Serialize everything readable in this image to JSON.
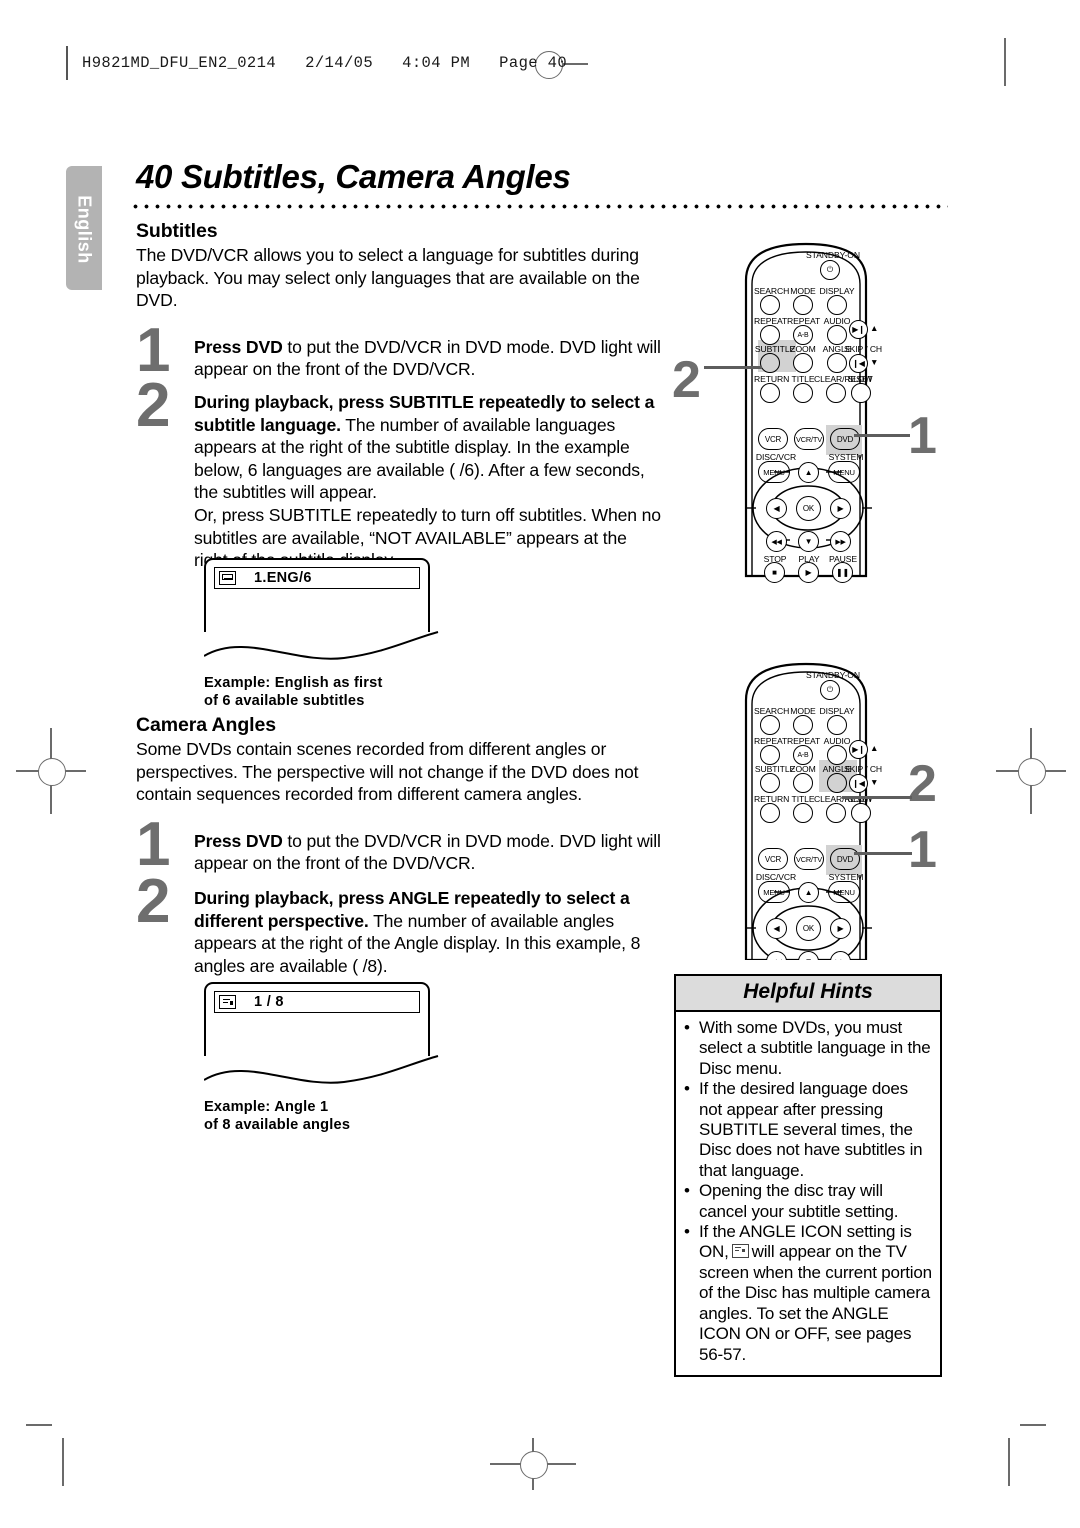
{
  "header": {
    "slug": "H9821MD_DFU_EN2_0214   2/14/05   4:04 PM   Page 40"
  },
  "lang_tab": {
    "label": "English"
  },
  "title": "40  Subtitles, Camera Angles",
  "sections": {
    "subtitles": {
      "heading": "Subtitles",
      "intro": "The DVD/VCR allows you to select a language for subtitles during playback. You may select only languages that are available on the DVD.",
      "step1": {
        "number": "1",
        "bold": "Press DVD",
        "rest": " to put the DVD/VCR in DVD mode. DVD light will appear on the front of the DVD/VCR."
      },
      "step2": {
        "number": "2",
        "bold": "During playback, press SUBTITLE repeatedly to select a subtitle language.",
        "rest": " The number of available languages appears at the right of the subtitle display. In the example below, 6 languages are available (  /6). After a few seconds, the subtitles will appear.",
        "rest2": "Or, press SUBTITLE repeatedly to turn off subtitles. When no subtitles are available, “NOT AVAILABLE” appears at the right of the subtitle display."
      },
      "osd": {
        "icon": "subtitle-icon",
        "value": "1.ENG/6",
        "caption_line1": "Example: English as first",
        "caption_line2": "of 6 available subtitles"
      }
    },
    "camera_angles": {
      "heading": "Camera Angles",
      "intro": "Some DVDs contain scenes recorded from different angles or perspectives. The perspective will not change if the DVD does not contain sequences recorded from different camera angles.",
      "step1": {
        "number": "1",
        "bold": "Press DVD",
        "rest": " to put the DVD/VCR in DVD mode. DVD light will appear on the front of the DVD/VCR."
      },
      "step2": {
        "number": "2",
        "bold": "During playback, press ANGLE repeatedly to select a different perspective.",
        "rest": " The number of available angles appears at the right of the Angle display. In this example, 8 angles are available (  /8)."
      },
      "osd": {
        "icon": "angle-icon",
        "value": "1 / 8",
        "caption_line1": "Example: Angle 1",
        "caption_line2": "of 8 available angles"
      }
    }
  },
  "helpful_hints": {
    "title": "Helpful Hints",
    "bullet": "•",
    "items": [
      "With some DVDs, you must select a subtitle language in the Disc menu.",
      "If the desired language does not appear after pressing SUBTITLE several times, the Disc does not have subtitles in that language.",
      "Opening the disc tray will cancel your subtitle setting."
    ],
    "item_angle_a": "If the ANGLE ICON setting is ON,",
    "item_angle_b": "will appear on the TV screen when the current portion of the Disc has multiple camera angles. To set the ANGLE ICON ON or OFF, see pages 56-57."
  },
  "remote": {
    "standby_label": "STANDBY-ON",
    "row1": [
      "SEARCH",
      "MODE",
      "DISPLAY"
    ],
    "row2": [
      "REPEAT",
      "REPEAT",
      "AUDIO"
    ],
    "row2_ab": "A-B",
    "row3": [
      "SUBTITLE",
      "ZOOM",
      "ANGLE"
    ],
    "row4": [
      "RETURN",
      "TITLE",
      "CLEAR/RESET",
      "SLOW"
    ],
    "skip_label": "SKIP / CH",
    "mode_row": [
      "VCR",
      "VCR/TV",
      "DVD"
    ],
    "menu_left_label": "DISC/VCR",
    "menu_right_label": "SYSTEM",
    "menu_btn": "MENU",
    "ok": "OK",
    "transport": [
      "STOP",
      "PLAY",
      "PAUSE"
    ]
  },
  "callouts": {
    "remote1_subtitle": "2",
    "remote1_dvd": "1",
    "remote2_angle": "2",
    "remote2_dvd": "1"
  },
  "colors": {
    "step_number": "#6e6e6e",
    "tab_gray": "#b3b3b3",
    "highlight": "#d2d2d2",
    "hints_header": "#dcdcdc"
  }
}
